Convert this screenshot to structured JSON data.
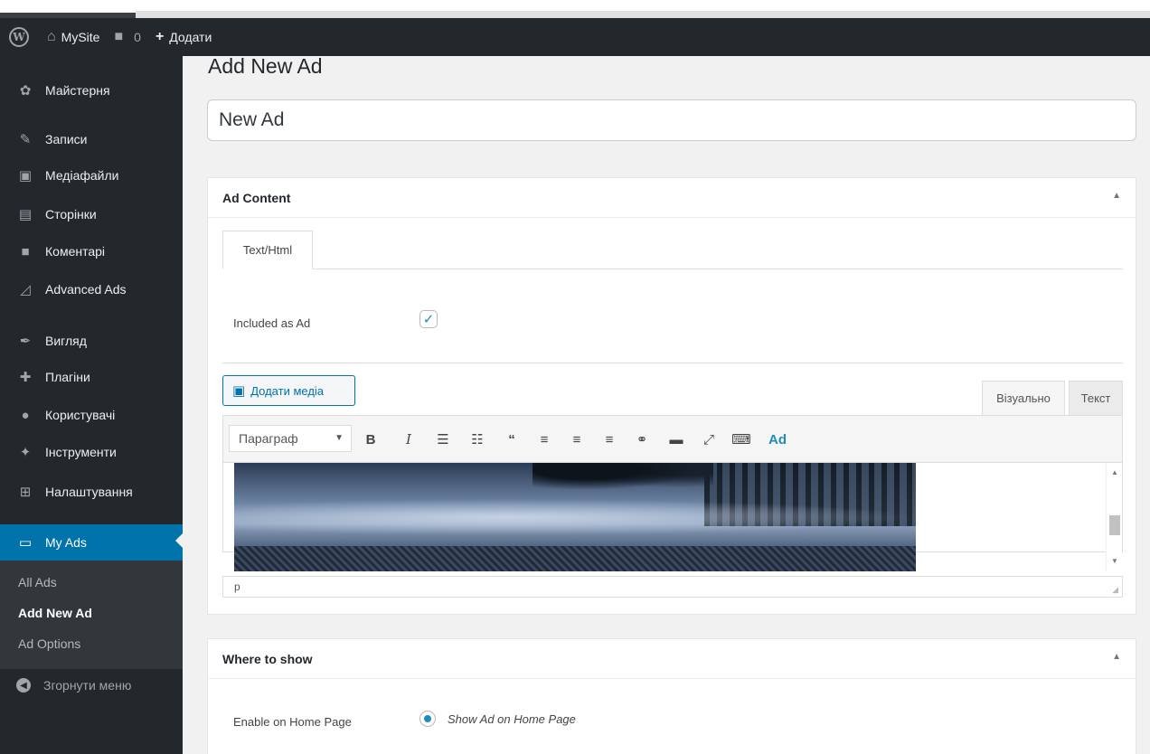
{
  "adminbar": {
    "logo": "W",
    "site_name": "MySite",
    "comments_count": "0",
    "add_label": "Додати"
  },
  "sidebar": {
    "items": [
      {
        "label": "Майстерня",
        "icon": "dashboard-icon",
        "glyph": "✿"
      },
      {
        "label": "Записи",
        "icon": "pin-icon",
        "glyph": "✎"
      },
      {
        "label": "Медіафайли",
        "icon": "media-icon",
        "glyph": "▣"
      },
      {
        "label": "Сторінки",
        "icon": "pages-icon",
        "glyph": "▤"
      },
      {
        "label": "Коментарі",
        "icon": "comment-icon",
        "glyph": "■"
      },
      {
        "label": "Advanced Ads",
        "icon": "chart-icon",
        "glyph": "◿"
      },
      {
        "label": "Вигляд",
        "icon": "appearance-icon",
        "glyph": "✒"
      },
      {
        "label": "Плагіни",
        "icon": "plugin-icon",
        "glyph": "✚"
      },
      {
        "label": "Користувачі",
        "icon": "users-icon",
        "glyph": "●"
      },
      {
        "label": "Інструменти",
        "icon": "tools-icon",
        "glyph": "✦"
      },
      {
        "label": "Налаштування",
        "icon": "settings-icon",
        "glyph": "⊞"
      },
      {
        "label": "My Ads",
        "icon": "ads-icon",
        "glyph": "▭"
      }
    ],
    "submenu": [
      "All Ads",
      "Add New Ad",
      "Ad Options"
    ],
    "collapse_label": "Згорнути меню"
  },
  "main": {
    "page_title": "Add New Ad",
    "title_value": "New Ad",
    "ad_content": {
      "header": "Ad Content",
      "tab_label": "Text/Html",
      "included_label": "Included as Ad",
      "included_checked": true,
      "media_button": "Додати медіа",
      "tab_visual": "Візуально",
      "tab_text": "Текст",
      "format_select": "Параграф",
      "toolbar_ad": "Ad",
      "path": "p"
    },
    "where_to_show": {
      "header": "Where to show",
      "enable_label": "Enable on Home Page",
      "radio_label": "Show Ad on Home Page",
      "radio_selected": true
    }
  },
  "colors": {
    "accent": "#0073aa",
    "adminbar": "#23282d",
    "sidebar": "#23282d"
  }
}
